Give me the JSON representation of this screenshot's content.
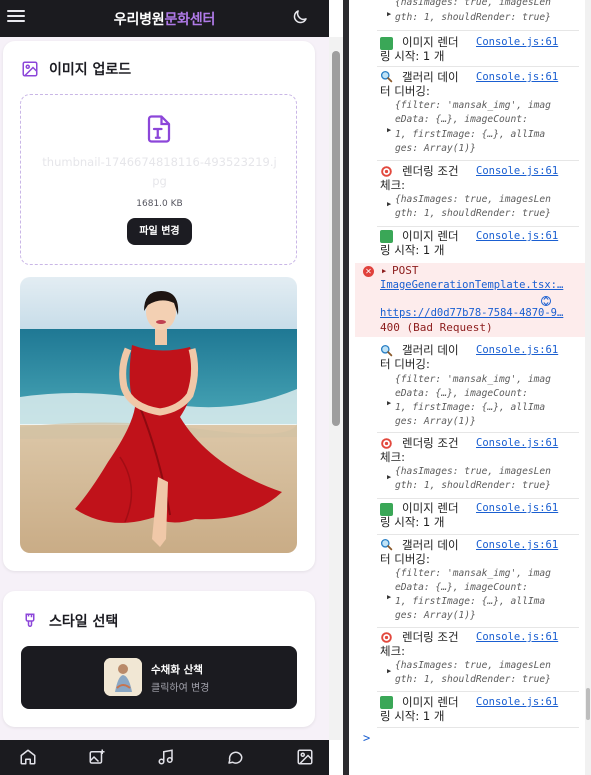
{
  "header": {
    "title_part1": "우리병원",
    "title_part2": "문화센터",
    "menu_icon": "hamburger-icon",
    "theme_icon": "moon-icon"
  },
  "upload": {
    "heading": "이미지 업로드",
    "file_name": "thumbnail-1746674818116-493523219.jpg",
    "file_size": "1681.0 KB",
    "change_button": "파일 변경"
  },
  "style_select": {
    "heading": "스타일 선택",
    "style_name": "수채화 산책",
    "style_hint": "클릭하여 변경"
  },
  "nav": {
    "items": [
      "home-icon",
      "image-plus-icon",
      "music-icon",
      "chat-icon",
      "gallery-icon"
    ]
  },
  "console": {
    "src": "Console.js:61",
    "render_start_a": "이미지 렌더",
    "render_start_b": "링 시작: 1 개",
    "gallery_a": "갤러리 데이",
    "gallery_b": "터 디버깅:",
    "cond_a": "렌더링 조건",
    "cond_b": "체크:",
    "cond_obj_1": "{hasImages: true, imagesLen",
    "cond_obj_2": "gth: 1, shouldRender: true}",
    "gal_obj_1": "{filter: 'mansak_img', imag",
    "gal_obj_2": "eData: {…}, imageCount:",
    "gal_obj_3": "1, firstImage: {…}, allIma",
    "gal_obj_4": "ges: Array(1)}",
    "error": {
      "method": "POST",
      "source": "ImageGenerationTemplate.tsx:…",
      "url": "https://d0d77b78-7584-4870-9…",
      "status": "400 (Bad Request)"
    },
    "prompt": ">"
  },
  "colors": {
    "accent": "#b07ae8",
    "dark": "#1b1b1f",
    "link": "#1a5fd1",
    "error_bg": "#fdecec"
  }
}
